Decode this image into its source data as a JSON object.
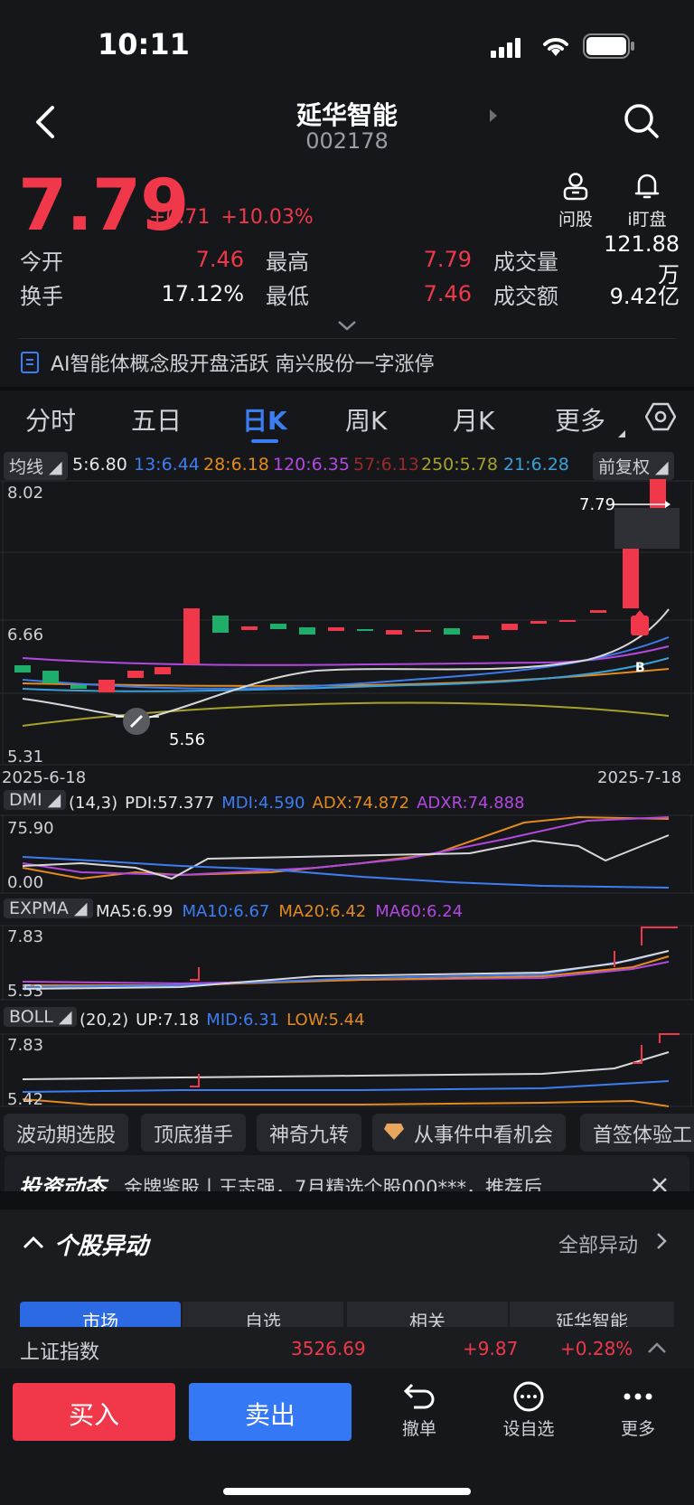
{
  "status": {
    "time": "10:11"
  },
  "header": {
    "title": "延华智能",
    "code": "002178"
  },
  "quote": {
    "price": "7.79",
    "change": "+0.71",
    "change_pct": "+10.03%",
    "actions": [
      {
        "label": "问股",
        "icon": "person-icon"
      },
      {
        "label": "i盯盘",
        "icon": "bell-icon"
      }
    ],
    "rows": [
      [
        {
          "k": "今开",
          "v": "7.46"
        },
        {
          "k": "最高",
          "v": "7.79"
        },
        {
          "k": "成交量",
          "v": "121.88万"
        }
      ],
      [
        {
          "k": "换手",
          "v": "17.12%"
        },
        {
          "k": "最低",
          "v": "7.46"
        },
        {
          "k": "成交额",
          "v": "9.42亿"
        }
      ]
    ]
  },
  "news_ticker": "AI智能体概念股开盘活跃 南兴股份一字涨停",
  "tabs": [
    "分时",
    "五日",
    "日K",
    "周K",
    "月K",
    "更多"
  ],
  "active_tab": "日K",
  "ma_bar": {
    "left_label": "均线",
    "right_label": "前复权",
    "items": [
      {
        "text": "5:6.80",
        "color": "#e6e6e6"
      },
      {
        "text": "13:6.44",
        "color": "#3d7df2"
      },
      {
        "text": "28:6.18",
        "color": "#e38a1c"
      },
      {
        "text": "120:6.35",
        "color": "#b348e0"
      },
      {
        "text": "57:6.13",
        "color": "#9b2a2a"
      },
      {
        "text": "250:5.78",
        "color": "#a6a22a"
      },
      {
        "text": "21:6.28",
        "color": "#3aa0d8"
      }
    ]
  },
  "kline": {
    "y_top": "8.02",
    "y_mid": "6.66",
    "y_bot": "5.31",
    "high_label": "7.79",
    "low_label": "5.56",
    "date_start": "2025-6-18",
    "date_end": "2025-7-18",
    "buy_marker": "B"
  },
  "chart_data": {
    "type": "candlestick",
    "x": [
      "2025-6-18",
      "",
      "",
      "",
      "",
      "",
      "",
      "",
      "",
      "",
      "",
      "",
      "",
      "",
      "",
      "",
      "",
      "",
      "",
      "",
      "",
      "",
      "2025-7-18"
    ],
    "ylim": [
      5.31,
      8.02
    ]
  },
  "dmi": {
    "name": "DMI",
    "params": "(14,3)",
    "pdi": "PDI:57.377",
    "mdi": "MDI:4.590",
    "adx": "ADX:74.872",
    "adxr": "ADXR:74.888",
    "y_top": "75.90",
    "y_bot": "0.00"
  },
  "expma": {
    "name": "EXPMA",
    "ma5": "MA5:6.99",
    "ma10": "MA10:6.67",
    "ma20": "MA20:6.42",
    "ma60": "MA60:6.24",
    "y_top": "7.83",
    "y_bot": "5.53"
  },
  "boll": {
    "name": "BOLL",
    "params": "(20,2)",
    "up": "UP:7.18",
    "mid": "MID:6.31",
    "low": "LOW:5.44",
    "y_top": "7.83",
    "y_bot": "5.42"
  },
  "feature_pills": [
    "波动期选股",
    "顶底猎手",
    "神奇九转",
    "从事件中看机会",
    "首签体验工"
  ],
  "invest": {
    "title": "投资动态",
    "text": "金牌鉴股丨王志强，7月精选个股000***，推荐后..."
  },
  "anomaly": {
    "title": "个股异动",
    "link": "全部异动",
    "tabs": [
      "市场",
      "自选",
      "相关",
      "延华智能"
    ]
  },
  "index_bar": {
    "name": "上证指数",
    "value": "3526.69",
    "change": "+9.87",
    "pct": "+0.28%"
  },
  "trade": {
    "buy": "买入",
    "sell": "卖出",
    "tools": [
      {
        "label": "撤单",
        "icon": "undo-icon"
      },
      {
        "label": "设自选",
        "icon": "more-dots-icon"
      },
      {
        "label": "更多",
        "icon": "ellipsis-icon"
      }
    ]
  }
}
